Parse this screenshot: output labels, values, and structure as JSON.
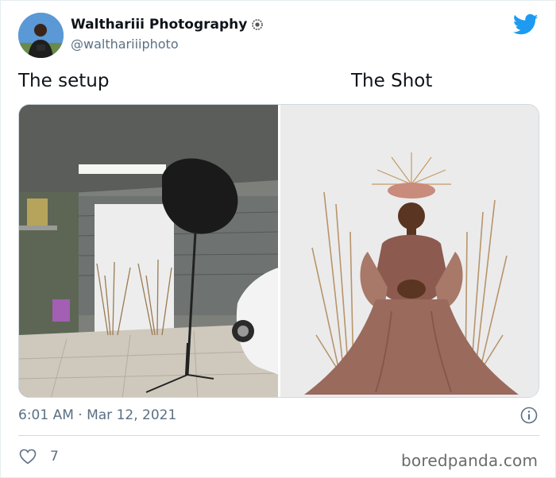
{
  "author": {
    "display_name": "Walthariii Photography",
    "handle": "@walthariiiphoto",
    "badge_icon": "sunflower-badge-icon",
    "avatar_icon": "profile-photo"
  },
  "brand": {
    "logo_icon": "twitter-bird-icon",
    "accent": "#1d9bf0"
  },
  "labels": {
    "left": "The setup",
    "right": "The Shot"
  },
  "media": {
    "left": {
      "alt": "Garage photo studio setup with umbrella light and backdrop"
    },
    "right": {
      "alt": "Portrait of woman in mauve gown with floral crown and dried grass"
    }
  },
  "meta": {
    "timestamp": "6:01 AM · Mar 12, 2021",
    "info_icon": "info-icon"
  },
  "actions": {
    "like_icon": "heart-icon",
    "like_count": "7"
  },
  "watermark": "boredpanda.com",
  "colors": {
    "text_primary": "#0f1419",
    "text_secondary": "#5b7083",
    "divider": "#cfd9de"
  }
}
